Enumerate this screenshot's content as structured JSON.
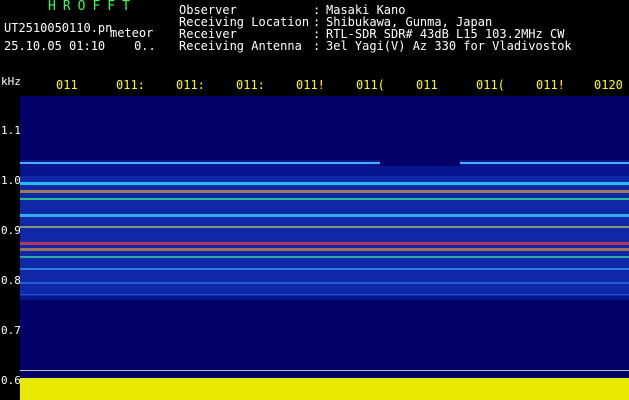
{
  "header": {
    "app_title": "HROFFT",
    "file_name": "UT2510050110.pn",
    "file_suffix": "meteor",
    "date_time": "25.10.05 01:10",
    "date_extra": "0..",
    "meta": [
      {
        "label": "Observer",
        "value": "Masaki Kano"
      },
      {
        "label": "Receiving Location",
        "value": "Shibukawa, Gunma, Japan"
      },
      {
        "label": "Receiver",
        "value": "RTL-SDR SDR# 43dB L15 103.2MHz CW"
      },
      {
        "label": "Receiving Antenna",
        "value": "3el Yagi(V) Az 330 for Vladivostok"
      }
    ],
    "separator": ":"
  },
  "spectrogram": {
    "unit_label": "kHz",
    "y_ticks": [
      "1.1",
      "1.0",
      "0.9",
      "0.8",
      "0.7",
      "0.6"
    ],
    "x_ticks": [
      "011",
      "011:",
      "011:",
      "011:",
      "011!",
      "011(",
      "011",
      "011(",
      "011!",
      "0120"
    ],
    "colors": {
      "background": "#000066",
      "footer": "#e8e800",
      "tick_text": "#ffff00",
      "title": "#32ff4a"
    }
  }
}
